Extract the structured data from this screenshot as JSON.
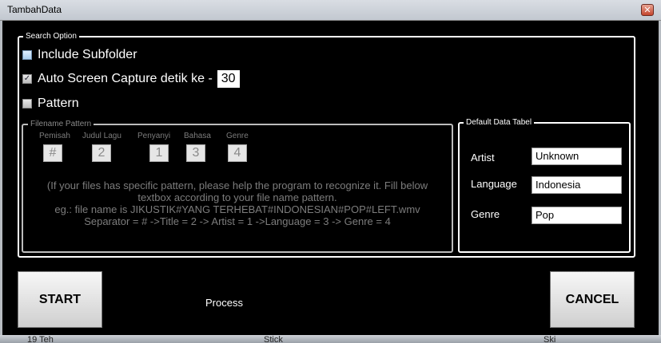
{
  "window": {
    "title": "TambahData",
    "close_glyph": "✕"
  },
  "search_option": {
    "label": "Search Option",
    "include_subfolder": {
      "label": "Include Subfolder",
      "checked": false
    },
    "auto_capture": {
      "label": "Auto Screen Capture detik ke -",
      "checked": true,
      "value": "30"
    },
    "pattern": {
      "label": "Pattern",
      "checked": false
    }
  },
  "filename_pattern": {
    "label": "Filename Pattern",
    "fields": [
      {
        "label": "Pemisah",
        "value": "#"
      },
      {
        "label": "Judul Lagu",
        "value": "2"
      },
      {
        "label": "Penyanyi",
        "value": "1"
      },
      {
        "label": "Bahasa",
        "value": "3"
      },
      {
        "label": "Genre",
        "value": "4"
      }
    ],
    "info_lines": [
      "(If your files has specific pattern, please help the program to recognize it. Fill below",
      "textbox according to your file name pattern.",
      "eg.: file name is JIKUSTIK#YANG TERHEBAT#INDONESIAN#POP#LEFT.wmv",
      "Separator = # ->Title =  2 -> Artist = 1 ->Language = 3 -> Genre = 4"
    ]
  },
  "default_data": {
    "label": "Default Data Tabel",
    "artist": {
      "label": "Artist",
      "value": "Unknown"
    },
    "language": {
      "label": "Language",
      "value": "Indonesia"
    },
    "genre": {
      "label": "Genre",
      "value": "Pop"
    }
  },
  "actions": {
    "start": "START",
    "cancel": "CANCEL",
    "process": "Process"
  },
  "background_text": {
    "left": "19 Teh",
    "mid": "Stick",
    "right": "Ski"
  }
}
